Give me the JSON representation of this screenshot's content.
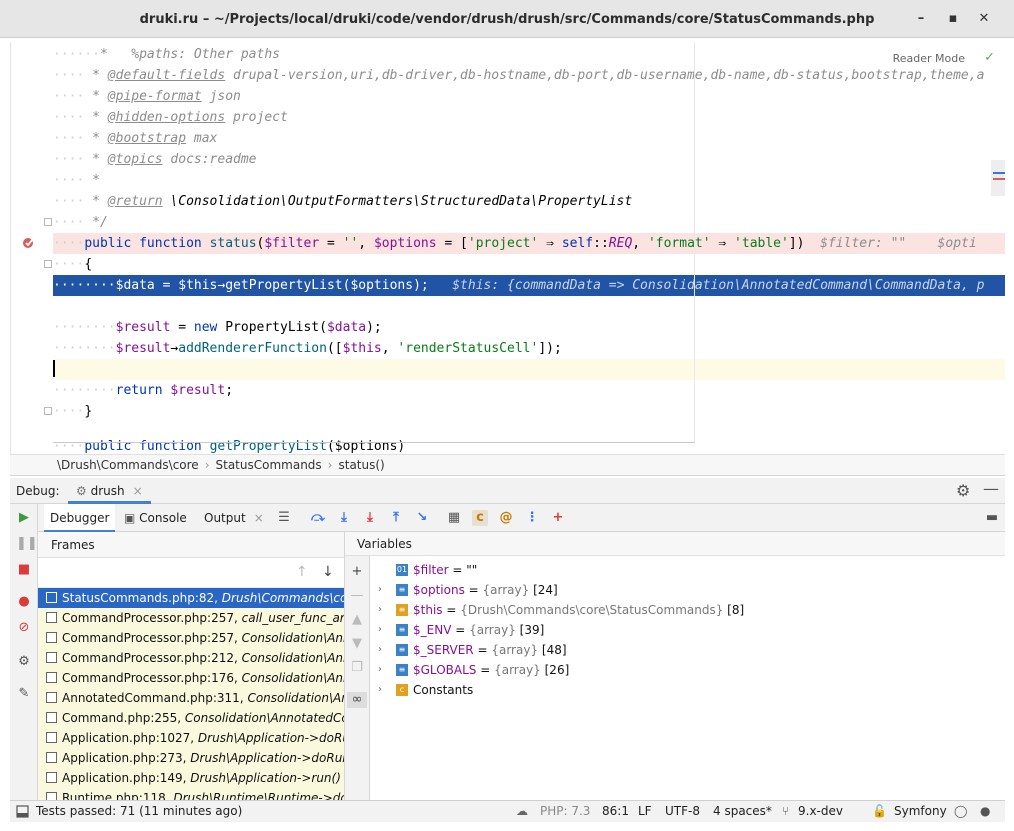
{
  "window": {
    "title": "druki.ru – ~/Projects/local/druki/code/vendor/drush/drush/src/Commands/core/StatusCommands.php",
    "minimize_glyph": "–",
    "maximize_glyph": "▪",
    "close_glyph": "✕"
  },
  "editor": {
    "reader_mode": "Reader Mode",
    "lines": {
      "l1": "%paths: Other paths",
      "l2_tag": "@default-fields",
      "l2_val": " drupal-version,uri,db-driver,db-hostname,db-port,db-username,db-name,db-status,bootstrap,theme,a",
      "l3_tag": "@pipe-format",
      "l3_val": " json",
      "l4_tag": "@hidden-options",
      "l4_val": " project",
      "l5_tag": "@bootstrap",
      "l5_val": " max",
      "l6_tag": "@topics",
      "l6_val": " docs:readme",
      "l8_tag": "@return",
      "l8_val": " \\Consolidation\\OutputFormatters\\StructuredData\\PropertyList",
      "l9": "*/",
      "l10_public": "public",
      "l10_function": "function",
      "l10_name": "status",
      "l10_p1": "(",
      "l10_filter": "$filter",
      "l10_eq1": " = ",
      "l10_s1": "''",
      "l10_comma": ", ",
      "l10_options": "$options",
      "l10_eq2": " = [",
      "l10_s2": "'project'",
      "l10_arrow": " ⇒ ",
      "l10_self": "self",
      "l10_dc": "::",
      "l10_req": "REQ",
      "l10_comma2": ", ",
      "l10_s3": "'format'",
      "l10_arrow2": " ⇒ ",
      "l10_s4": "'table'",
      "l10_close": "])",
      "l10_inline": "  $filter: \"\"    $opti",
      "l11": "{",
      "l12_data": "$data",
      "l12_mid": " = ",
      "l12_this": "$this",
      "l12_call": "→getPropertyList(",
      "l12_opt": "$options",
      "l12_end": ");",
      "l12_inline": "   $this: {commandData => Consolidation\\AnnotatedCommand\\CommandData, p",
      "l14_result": "$result",
      "l14_mid": " = ",
      "l14_new": "new",
      "l14_cls": " PropertyList(",
      "l14_data": "$data",
      "l14_end": ");",
      "l15_result": "$result",
      "l15_call": "→",
      "l15_fn": "addRendererFunction",
      "l15_p": "([",
      "l15_this": "$this",
      "l15_comma": ", ",
      "l15_str": "'renderStatusCell'",
      "l15_end": "]);",
      "l17_return": "return",
      "l17_result": " $result",
      "l17_end": ";",
      "l18": "}",
      "l20_public": "public",
      "l20_function": "function",
      "l20_name": "getPropertyList",
      "l20_rest": "($options)"
    }
  },
  "breadcrumb": {
    "namespace": "\\Drush\\Commands\\core",
    "class": "StatusCommands",
    "method": "status()"
  },
  "debug": {
    "label": "Debug:",
    "session_tab": "drush",
    "tabs": {
      "debugger": "Debugger",
      "console": "Console",
      "output": "Output"
    },
    "frames_title": "Frames",
    "variables_title": "Variables",
    "frames": [
      {
        "file": "StatusCommands.php:82,",
        "loc": " Drush\\Commands\\core\\StatusCommands->status()"
      },
      {
        "file": "CommandProcessor.php:257,",
        "loc": " call_user_func_array()"
      },
      {
        "file": "CommandProcessor.php:257,",
        "loc": " Consolidation\\AnnotatedCommand\\CommandProcessor->runCommandCallback()"
      },
      {
        "file": "CommandProcessor.php:212,",
        "loc": " Consolidation\\AnnotatedCommand\\CommandProcessor->validateRunAndAlter()"
      },
      {
        "file": "CommandProcessor.php:176,",
        "loc": " Consolidation\\AnnotatedCommand\\CommandProcessor->process()"
      },
      {
        "file": "AnnotatedCommand.php:311,",
        "loc": " Consolidation\\AnnotatedCommand\\AnnotatedCommand->execute()"
      },
      {
        "file": "Command.php:255,",
        "loc": " Consolidation\\AnnotatedCommand\\AnnotatedCommand->run()"
      },
      {
        "file": "Application.php:1027,",
        "loc": " Drush\\Application->doRunCommand()"
      },
      {
        "file": "Application.php:273,",
        "loc": " Drush\\Application->doRun()"
      },
      {
        "file": "Application.php:149,",
        "loc": " Drush\\Application->run()"
      },
      {
        "file": "Runtime.php:118,",
        "loc": " Drush\\Runtime\\Runtime->doRun()"
      }
    ],
    "variables": [
      {
        "name": "$filter",
        "eq": " = ",
        "type": "",
        "value": "\"\"",
        "icon": "01",
        "color": "#3b82c4",
        "expand": ""
      },
      {
        "name": "$options",
        "eq": " = ",
        "type": "{array}",
        "value": " [24]",
        "icon": "≡",
        "color": "#3b82c4",
        "expand": "›"
      },
      {
        "name": "$this",
        "eq": " = ",
        "type": "{Drush\\Commands\\core\\StatusCommands}",
        "value": " [8]",
        "icon": "≡",
        "color": "#e0a020",
        "expand": "›"
      },
      {
        "name": "$_ENV",
        "eq": " = ",
        "type": "{array}",
        "value": " [39]",
        "icon": "≡",
        "color": "#3b82c4",
        "expand": "›"
      },
      {
        "name": "$_SERVER",
        "eq": " = ",
        "type": "{array}",
        "value": " [48]",
        "icon": "≡",
        "color": "#3b82c4",
        "expand": "›"
      },
      {
        "name": "$GLOBALS",
        "eq": " = ",
        "type": "{array}",
        "value": " [26]",
        "icon": "≡",
        "color": "#3b82c4",
        "expand": "›"
      },
      {
        "name": "Constants",
        "eq": "",
        "type": "",
        "value": "",
        "icon": "c",
        "color": "#e0a020",
        "expand": "›"
      }
    ]
  },
  "status": {
    "tests": "Tests passed: 71 (11 minutes ago)",
    "php": "PHP: 7.3",
    "position": "86:1",
    "line_sep": "LF",
    "encoding": "UTF-8",
    "indent": "4 spaces*",
    "branch": "9.x-dev",
    "framework": "Symfony"
  }
}
